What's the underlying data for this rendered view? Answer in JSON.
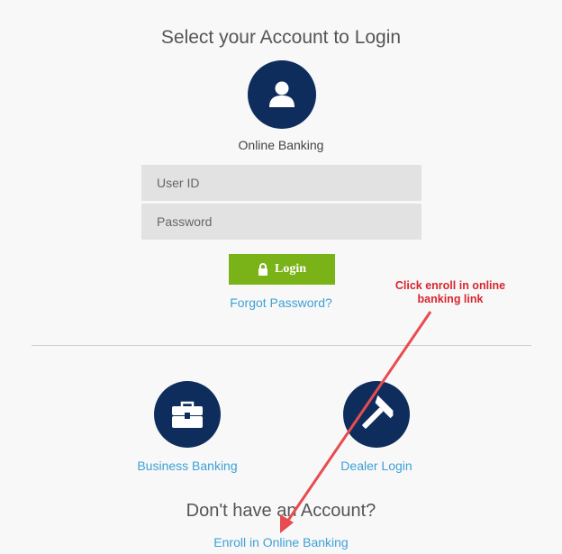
{
  "page": {
    "title": "Select your Account to Login"
  },
  "online_banking": {
    "label": "Online Banking",
    "icon": "user-icon",
    "user_id_placeholder": "User ID",
    "password_placeholder": "Password",
    "login_label": "Login",
    "forgot_label": "Forgot Password?"
  },
  "business": {
    "label": "Business Banking",
    "icon": "briefcase-icon"
  },
  "dealer": {
    "label": "Dealer Login",
    "icon": "hammer-icon"
  },
  "footer": {
    "no_account": "Don't have an Account?",
    "enroll_label": "Enroll in Online Banking"
  },
  "annotation": {
    "text": "Click enroll in online banking link"
  },
  "colors": {
    "navy": "#0f2d5c",
    "login_green": "#7ab317",
    "link_blue": "#3ea0d6",
    "annotation_red": "#d8262d"
  }
}
